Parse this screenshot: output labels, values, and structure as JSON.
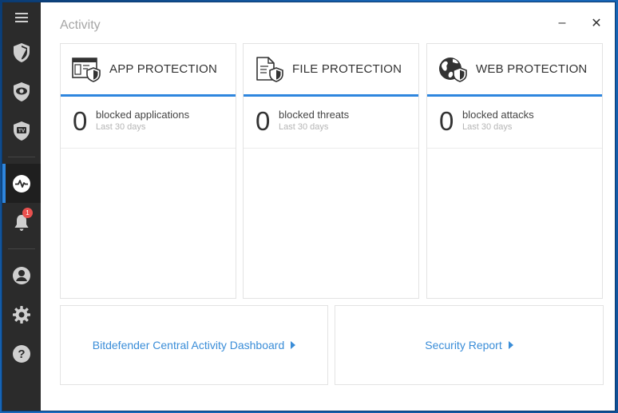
{
  "window": {
    "title": "Activity",
    "minimize_glyph": "–",
    "close_glyph": "✕"
  },
  "sidebar": {
    "items": [
      {
        "name": "menu",
        "icon": "hamburger-menu-icon"
      },
      {
        "name": "protection",
        "icon": "shield-icon"
      },
      {
        "name": "privacy",
        "icon": "eye-shield-icon"
      },
      {
        "name": "utilities",
        "icon": "tv-shield-icon"
      },
      {
        "name": "activity",
        "icon": "activity-pulse-icon",
        "active": true
      },
      {
        "name": "notifications",
        "icon": "bell-icon",
        "badge": "1"
      },
      {
        "name": "account",
        "icon": "user-icon"
      },
      {
        "name": "settings",
        "icon": "gear-icon"
      },
      {
        "name": "help",
        "icon": "question-icon"
      }
    ]
  },
  "cards": [
    {
      "title": "APP PROTECTION",
      "icon": "app-shield-icon",
      "value": "0",
      "label": "blocked applications",
      "sub": "Last 30 days"
    },
    {
      "title": "FILE PROTECTION",
      "icon": "file-shield-icon",
      "value": "0",
      "label": "blocked threats",
      "sub": "Last 30 days"
    },
    {
      "title": "WEB PROTECTION",
      "icon": "globe-shield-icon",
      "value": "0",
      "label": "blocked attacks",
      "sub": "Last 30 days"
    }
  ],
  "links": {
    "dashboard": "Bitdefender Central Activity Dashboard",
    "report": "Security Report"
  },
  "colors": {
    "accent": "#2e86de",
    "link": "#3a8dd8",
    "sidebar": "#2b2b2b",
    "badge": "#e9514f"
  }
}
